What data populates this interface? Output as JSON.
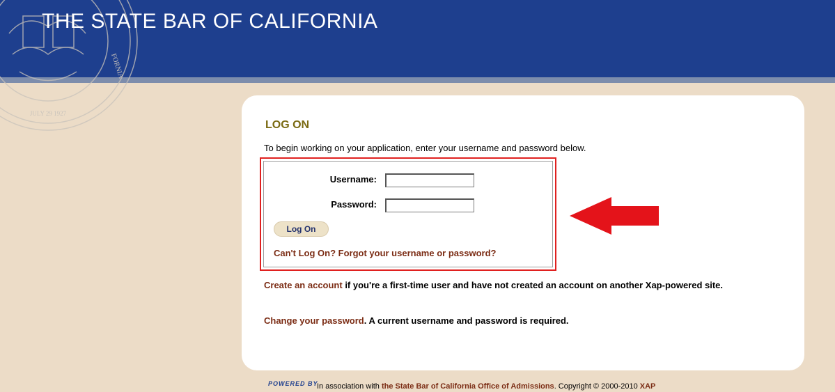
{
  "header": {
    "title": "THE STATE BAR OF CALIFORNIA",
    "seal_text_date": "JULY 29 1927",
    "seal_text_name": "FORNIA"
  },
  "logon": {
    "heading": "LOG ON",
    "intro": "To begin working on your application, enter your username and password below.",
    "username_label": "Username:",
    "username_value": "",
    "password_label": "Password:",
    "password_value": "",
    "button_label": "Log On",
    "forgot_link": "Can't Log On? Forgot your username or password?"
  },
  "create": {
    "link": "Create an account",
    "text": " if you're a first-time user and have not created an account on another Xap-powered site."
  },
  "change": {
    "link": "Change your password",
    "text": ". A current username and password is required."
  },
  "footer": {
    "powered_by": "POWERED BY",
    "prefix": "In association with ",
    "org_link": "the State Bar of California Office of Admissions",
    "copyright": ". Copyright © 2000-2010 ",
    "xap": "XAP"
  },
  "colors": {
    "header_blue": "#1e3f8e",
    "page_bg": "#ecdcc7",
    "highlight_red": "#e0201f",
    "link_brown": "#7b2c14"
  }
}
